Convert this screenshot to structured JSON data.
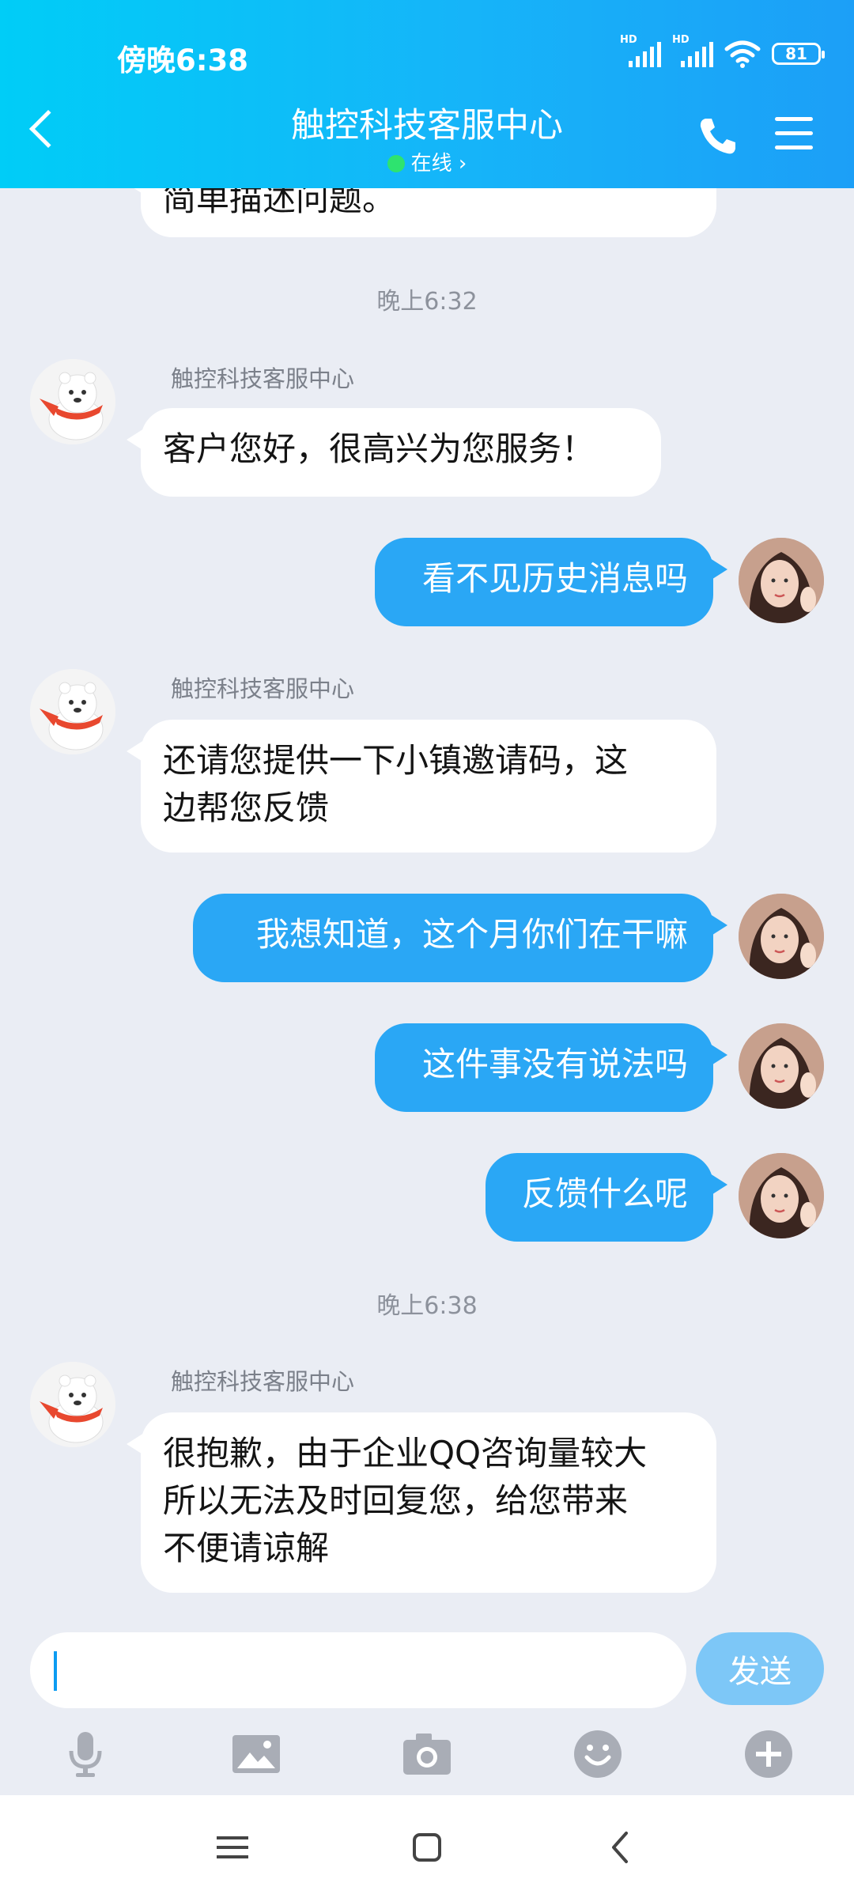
{
  "status_bar": {
    "time": "傍晚6:38",
    "battery": "81",
    "signal_label": "HD"
  },
  "header": {
    "title": "触控科技客服中心",
    "status": "在线 ›"
  },
  "messages": {
    "m0": {
      "text": "简单描述问题。"
    },
    "t1": "晚上6:32",
    "m1": {
      "sender": "触控科技客服中心",
      "text": "客户您好，很高兴为您服务！"
    },
    "m2": {
      "text": "看不见历史消息吗"
    },
    "m3": {
      "sender": "触控科技客服中心",
      "line1": "还请您提供一下小镇邀请码，这",
      "line2": "边帮您反馈"
    },
    "m4": {
      "text": "我想知道，这个月你们在干嘛"
    },
    "m5": {
      "text": "这件事没有说法吗"
    },
    "m6": {
      "text": "反馈什么呢"
    },
    "t2": "晚上6:38",
    "m7": {
      "sender": "触控科技客服中心",
      "line1": "很抱歉，由于企业QQ咨询量较大",
      "line2": "所以无法及时回复您，给您带来",
      "line3": "不便请谅解"
    }
  },
  "input": {
    "value": "",
    "send_label": "发送"
  },
  "toolbar": {
    "icons": [
      "microphone-icon",
      "image-icon",
      "camera-icon",
      "emoji-icon",
      "plus-icon"
    ]
  },
  "colors": {
    "header_start": "#00cdf7",
    "header_end": "#1c9ff7",
    "outgoing_bubble": "#2aa7f5",
    "send_button": "#7dc7f7",
    "chat_bg": "#eaedf4"
  }
}
